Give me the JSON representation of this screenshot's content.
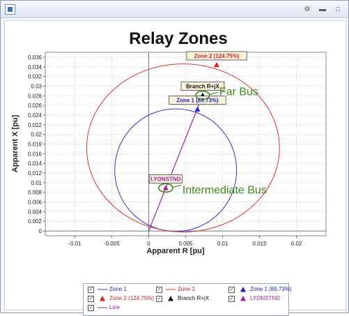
{
  "window": {
    "title": "",
    "buttons": [
      "settings",
      "minimize",
      "maximize"
    ]
  },
  "chart_data": {
    "type": "scatter",
    "title": "Relay Zones",
    "xlabel": "Apparent R [pu]",
    "ylabel": "Apparent X [pu]",
    "xlim": [
      -0.014,
      0.024
    ],
    "ylim": [
      -0.001,
      0.037
    ],
    "xticks": [
      -0.01,
      -0.005,
      0,
      0.005,
      0.01,
      0.015,
      0.02
    ],
    "xtick_labels": [
      "-0.01",
      "-0.005",
      "0",
      "0.005",
      "0.01",
      "0.015",
      "0.02"
    ],
    "yticks": [
      0,
      0.002,
      0.004,
      0.006,
      0.008,
      0.01,
      0.012,
      0.014,
      0.016,
      0.018,
      0.02,
      0.022,
      0.024,
      0.026,
      0.028,
      0.03,
      0.032,
      0.034,
      0.036
    ],
    "ytick_labels": [
      "0",
      "0.002",
      "0.004",
      "0.006",
      "0.008",
      "0.01",
      "0.012",
      "0.014",
      "0.016",
      "0.018",
      "0.02",
      "0.022",
      "0.024",
      "0.026",
      "0.028",
      "0.03",
      "0.032",
      "0.034",
      "0.036"
    ],
    "grid": true,
    "grid_style": "dotted",
    "series": [
      {
        "name": "Zone 1",
        "kind": "circle",
        "color": "#3333dd",
        "center": [
          0.00365,
          0.0126
        ],
        "radius_x": 0.00825,
        "radius_y": 0.0127
      },
      {
        "name": "Zone 2",
        "kind": "circle",
        "color": "#e03030",
        "center": [
          0.00465,
          0.0172
        ],
        "radius_x": 0.01305,
        "radius_y": 0.0174
      },
      {
        "name": "Zone 1 (89.73%)",
        "kind": "marker",
        "marker": "triangle",
        "color": "#2222cc",
        "x": 0.0066,
        "y": 0.0252,
        "label": "Zone 1 (89.73%)"
      },
      {
        "name": "Zone 2 (124.75%)",
        "kind": "marker",
        "marker": "triangle",
        "color": "#e02020",
        "x": 0.0092,
        "y": 0.0344,
        "label": "Zone 2 (124.75%)"
      },
      {
        "name": "Branch R+jX",
        "kind": "marker",
        "marker": "triangle",
        "color": "#111111",
        "x": 0.0073,
        "y": 0.0281,
        "label": "Branch R+jX"
      },
      {
        "name": "LYONSTND",
        "kind": "marker",
        "marker": "triangle",
        "color": "#a020a0",
        "x": 0.0023,
        "y": 0.0089,
        "label": "LYONSTND"
      },
      {
        "name": "Line",
        "kind": "line",
        "color": "#a020a0",
        "points": [
          [
            0.0,
            0.0
          ],
          [
            0.0073,
            0.0281
          ]
        ]
      }
    ],
    "annotations": [
      {
        "text": "Far Bus",
        "color": "#3a8a1a",
        "ring": [
          0.0073,
          0.0281
        ]
      },
      {
        "text": "Intermediate Bus",
        "color": "#3a8a1a",
        "ring": [
          0.0023,
          0.0089
        ]
      }
    ],
    "legend": {
      "placement": "bottom",
      "items": [
        {
          "label": "Zone 1",
          "symbol": "line",
          "color": "#3333dd",
          "text_color": "#2222cc"
        },
        {
          "label": "Zone 2",
          "symbol": "line",
          "color": "#e03030",
          "text_color": "#cc2020"
        },
        {
          "label": "Zone 1 (89.73%)",
          "symbol": "triangle",
          "color": "#2222cc",
          "text_color": "#2222cc"
        },
        {
          "label": "Zone 2 (124.75%)",
          "symbol": "triangle",
          "color": "#e02020",
          "text_color": "#cc2020"
        },
        {
          "label": "Branch R+jX",
          "symbol": "triangle",
          "color": "#111111",
          "text_color": "#111111"
        },
        {
          "label": "LYONSTND",
          "symbol": "triangle",
          "color": "#a020a0",
          "text_color": "#a020a0"
        },
        {
          "label": "Line",
          "symbol": "line",
          "color": "#a020a0",
          "text_color": "#a020a0"
        }
      ]
    }
  }
}
